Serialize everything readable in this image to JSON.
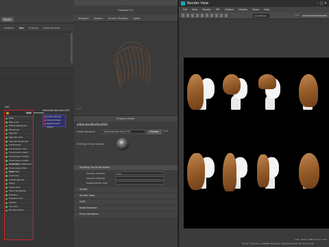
{
  "left": {
    "home_button": "Home",
    "nav": [
      "Untitled",
      "Tabs",
      "Projects",
      "Asset Browser"
    ],
    "node1": {
      "title": "hair",
      "attributes": [
        "Base",
        "Base color",
        "Diffuse Roughness",
        "Roughness",
        "Specular",
        "Specular Color",
        "Specular Roughness",
        "Transmission",
        "Transmission Color",
        "Transmission Depth",
        "Transmission Scatter",
        "Transmission Scatter Anisotropy",
        "Transmission Dispersion",
        "Transmission Extra Roughness",
        "Coat",
        "Coat Color",
        "Coat Roughness",
        "Sheen",
        "Sheen Color",
        "Sheen Roughness",
        "Emission",
        "Emission Color",
        "Opacity",
        "Thin Film",
        "Normal Camera"
      ]
    },
    "node2": {
      "title": "aiStandardSurface2SG",
      "rows": [
        "Surface Shader",
        "Volume Shader",
        "Displacement Shader"
      ]
    }
  },
  "center": {
    "viewport_title": "Viewport 2.0",
    "vp_menu": [
      "Viewport",
      "Options",
      "Arnold / Shading",
      "Lights"
    ],
    "props_title": "Property Editor",
    "tab": "aiStandardSurface2SG",
    "shading_group_label": "shadingEngine:",
    "shading_group_value": "aiStandardSurface2SG",
    "presets": "Presets",
    "sample_label": "Shading Group Sample",
    "sections": [
      "Shading Group Attributes",
      "Arnold",
      "Render Stats",
      "UUID",
      "Node Behavior",
      "Extra Attributes"
    ],
    "attrs": [
      {
        "label": "Surface material",
        "value": "hair"
      },
      {
        "label": "Volume material",
        "value": ""
      },
      {
        "label": "Displacement mat.",
        "value": ""
      }
    ]
  },
  "render_view": {
    "title": "Render View",
    "menu": [
      "File",
      "View",
      "Render",
      "IPR",
      "Options",
      "Display",
      "Show",
      "Help"
    ],
    "camera": "perspShape",
    "zoom": "1:1",
    "status_line1": "size: 1920 x 1080 zoom: 0.167",
    "status_line2": "Frame: 1   Memory: 1083Mb   Sampling: [3/4/3/3/2/3]   Render Time: 0:42"
  }
}
